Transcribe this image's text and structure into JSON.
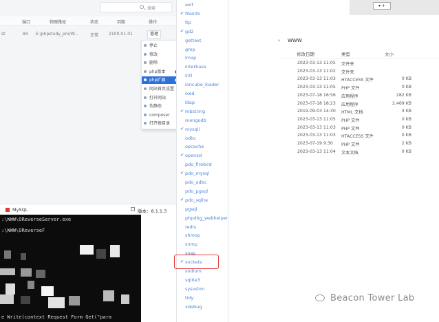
{
  "search": {
    "placeholder": "搜索"
  },
  "site_table": {
    "headers": [
      "端口",
      "物理路径",
      "状态",
      "到期",
      "操作"
    ],
    "row": [
      "84",
      "E:/phpstudy_pro/W...",
      "正常",
      "2100-01-01",
      "管理"
    ],
    "row_left": "st"
  },
  "context_menu": {
    "items": [
      {
        "label": "停止",
        "submenu": false,
        "active": false
      },
      {
        "label": "修改",
        "submenu": false,
        "active": false
      },
      {
        "label": "删除",
        "submenu": false,
        "active": false
      },
      {
        "label": "php版本",
        "submenu": true,
        "active": false
      },
      {
        "label": "php扩展",
        "submenu": true,
        "active": true
      },
      {
        "label": "网站首页设置",
        "submenu": false,
        "active": false
      },
      {
        "label": "打开网站",
        "submenu": false,
        "active": false
      },
      {
        "label": "伪静态",
        "submenu": false,
        "active": false
      },
      {
        "label": "composer",
        "submenu": false,
        "active": false
      },
      {
        "label": "打开根目录",
        "submenu": false,
        "active": false
      }
    ]
  },
  "extensions": [
    {
      "name": "exif",
      "checked": false
    },
    {
      "name": "fileinfo",
      "checked": true
    },
    {
      "name": "ftp",
      "checked": false
    },
    {
      "name": "gd2",
      "checked": true
    },
    {
      "name": "gettext",
      "checked": false
    },
    {
      "name": "gmp",
      "checked": false
    },
    {
      "name": "imap",
      "checked": false
    },
    {
      "name": "interbase",
      "checked": false
    },
    {
      "name": "intl",
      "checked": false
    },
    {
      "name": "ioncube_loader",
      "checked": false
    },
    {
      "name": "ixed",
      "checked": false
    },
    {
      "name": "ldap",
      "checked": false
    },
    {
      "name": "mbstring",
      "checked": true
    },
    {
      "name": "mongodb",
      "checked": false
    },
    {
      "name": "mysqli",
      "checked": true
    },
    {
      "name": "odbc",
      "checked": false
    },
    {
      "name": "opcache",
      "checked": false
    },
    {
      "name": "openssl",
      "checked": true
    },
    {
      "name": "pdo_firebird",
      "checked": false
    },
    {
      "name": "pdo_mysql",
      "checked": true
    },
    {
      "name": "pdo_odbc",
      "checked": false
    },
    {
      "name": "pdo_pgsql",
      "checked": false
    },
    {
      "name": "pdo_sqlite",
      "checked": true
    },
    {
      "name": "pgsql",
      "checked": false
    },
    {
      "name": "phpdbg_webhelper",
      "checked": false
    },
    {
      "name": "redis",
      "checked": false
    },
    {
      "name": "shmop",
      "checked": false
    },
    {
      "name": "snmp",
      "checked": false
    },
    {
      "name": "soap",
      "checked": false
    },
    {
      "name": "sockets",
      "checked": true
    },
    {
      "name": "sodium",
      "checked": false
    },
    {
      "name": "sqlite3",
      "checked": false
    },
    {
      "name": "sysvshm",
      "checked": false
    },
    {
      "name": "tidy",
      "checked": false
    },
    {
      "name": "xdebug",
      "checked": false
    }
  ],
  "mysql_bar": {
    "label": "MySQL",
    "version_label": "版本：8.1.1.3"
  },
  "console": {
    "lines": [
      ":\\WWW\\OReverseServer.exe",
      ":\\WWW\\OReverseF",
      "e Write(context Request Form Get(\"para"
    ]
  },
  "explorer": {
    "mini_control": "▾ +",
    "path": [
      "›",
      "WWW"
    ],
    "headers": [
      "修改日期",
      "类型",
      "大小"
    ],
    "rows": [
      {
        "date": "2023-03-13 11:05",
        "type": "文件夹",
        "size": ""
      },
      {
        "date": "2023-03-13 11:02",
        "type": "文件夹",
        "size": ""
      },
      {
        "date": "2023-03-13 11:03",
        "type": "HTACCESS 文件",
        "size": "0 KB"
      },
      {
        "date": "2023-03-13 11:05",
        "type": "PHP 文件",
        "size": "0 KB"
      },
      {
        "date": "2023-07-18 16:56",
        "type": "应用程序",
        "size": "282 KB"
      },
      {
        "date": "2023-07-18 18:23",
        "type": "应用程序",
        "size": "2,469 KB"
      },
      {
        "date": "2019-09-03 14:30",
        "type": "HTML 文档",
        "size": "3 KB"
      },
      {
        "date": "2023-03-13 11:05",
        "type": "PHP 文件",
        "size": "0 KB"
      },
      {
        "date": "2023-03-13 11:03",
        "type": "PHP 文件",
        "size": "0 KB"
      },
      {
        "date": "2023-03-13 11:03",
        "type": "HTACCESS 文件",
        "size": "0 KB"
      },
      {
        "date": "2023-07-19 9:30",
        "type": "PHP 文件",
        "size": "2 KB"
      },
      {
        "date": "2023-03-13 11:04",
        "type": "文本文档",
        "size": "0 KB"
      }
    ]
  },
  "watermark": {
    "text": "Beacon Tower Lab"
  },
  "colors": {
    "accent": "#2d72d9",
    "extension_text": "#4a86d8",
    "highlight": "#e23b3b",
    "console_bg": "#0c0c0c"
  }
}
